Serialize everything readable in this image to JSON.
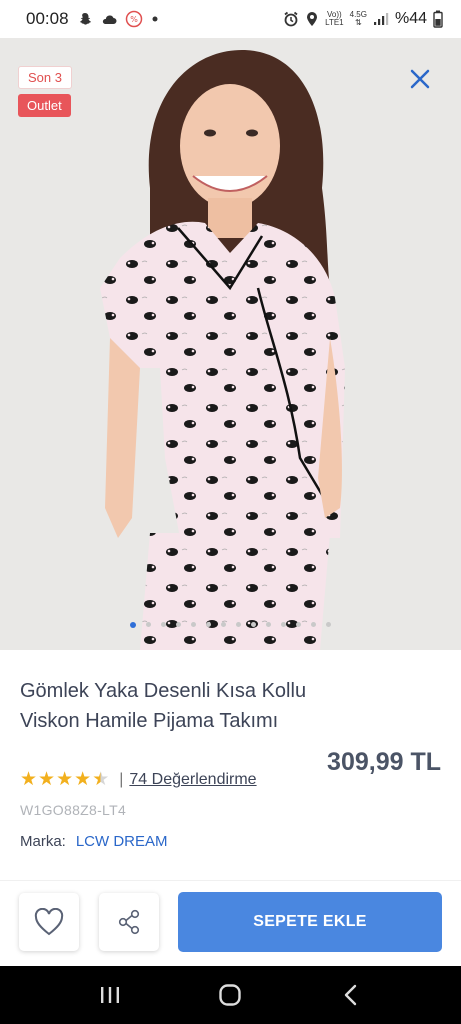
{
  "status_bar": {
    "time": "00:08",
    "network_top": "Vo))",
    "network_bottom": "LTE1",
    "signal_top": "4.5G",
    "battery": "%44",
    "icons": [
      "snapchat-icon",
      "cloud-icon",
      "notification-icon",
      "dot-icon",
      "alarm-icon",
      "location-icon",
      "signal-icon",
      "battery-icon"
    ]
  },
  "product_image": {
    "badges": {
      "stock": "Son 3",
      "outlet": "Outlet"
    },
    "close_icon": "close-icon",
    "gallery": {
      "count": 14,
      "active_index": 0
    }
  },
  "product": {
    "title": "Gömlek Yaka Desenli Kısa Kollu Viskon Hamile Pijama Takımı",
    "price": "309,99 TL",
    "rating": 4.5,
    "separator": "|",
    "review_text": "74 Değerlendirme",
    "sku": "W1GO88Z8-LT4",
    "brand_label": "Marka:",
    "brand_value": "LCW DREAM"
  },
  "actions": {
    "favorite_icon": "heart-icon",
    "share_icon": "share-icon",
    "add_to_cart": "SEPETE EKLE"
  },
  "nav_bar": {
    "icons": [
      "recent-apps-icon",
      "home-icon",
      "back-icon"
    ]
  },
  "colors": {
    "accent": "#4a87e0",
    "outlet_badge": "#e8555a",
    "star": "#f2b01e",
    "brand_link": "#2a67c9"
  }
}
